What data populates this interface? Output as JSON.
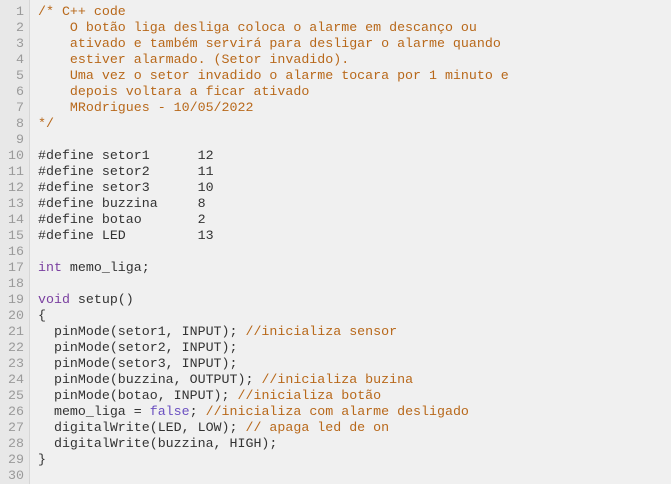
{
  "editor": {
    "colors": {
      "comment": "#b8681a",
      "keyword": "#7a3fa0",
      "literal": "#6a4fc0",
      "code": "#333333",
      "line_number": "#9a9a9a"
    },
    "lines": [
      {
        "n": "1",
        "tokens": [
          {
            "t": "/* C++ code",
            "c": "comment"
          }
        ]
      },
      {
        "n": "2",
        "tokens": [
          {
            "t": "    O botão liga desliga coloca o alarme em descanço ou",
            "c": "comment"
          }
        ]
      },
      {
        "n": "3",
        "tokens": [
          {
            "t": "    ativado e também servirá para desligar o alarme quando",
            "c": "comment"
          }
        ]
      },
      {
        "n": "4",
        "tokens": [
          {
            "t": "    estiver alarmado. (Setor invadido).",
            "c": "comment"
          }
        ]
      },
      {
        "n": "5",
        "tokens": [
          {
            "t": "    Uma vez o setor invadido o alarme tocara por 1 minuto e",
            "c": "comment"
          }
        ]
      },
      {
        "n": "6",
        "tokens": [
          {
            "t": "    depois voltara a ficar ativado",
            "c": "comment"
          }
        ]
      },
      {
        "n": "7",
        "tokens": [
          {
            "t": "    MRodrigues - 10/05/2022",
            "c": "comment"
          }
        ]
      },
      {
        "n": "8",
        "tokens": [
          {
            "t": "*/",
            "c": "comment"
          }
        ]
      },
      {
        "n": "9",
        "tokens": []
      },
      {
        "n": "10",
        "tokens": [
          {
            "t": "#define setor1      12",
            "c": "code"
          }
        ]
      },
      {
        "n": "11",
        "tokens": [
          {
            "t": "#define setor2      11",
            "c": "code"
          }
        ]
      },
      {
        "n": "12",
        "tokens": [
          {
            "t": "#define setor3      10",
            "c": "code"
          }
        ]
      },
      {
        "n": "13",
        "tokens": [
          {
            "t": "#define buzzina     8",
            "c": "code"
          }
        ]
      },
      {
        "n": "14",
        "tokens": [
          {
            "t": "#define botao       2",
            "c": "code"
          }
        ]
      },
      {
        "n": "15",
        "tokens": [
          {
            "t": "#define LED         13",
            "c": "code"
          }
        ]
      },
      {
        "n": "16",
        "tokens": []
      },
      {
        "n": "17",
        "tokens": [
          {
            "t": "int",
            "c": "kw"
          },
          {
            "t": " memo_liga;",
            "c": "code"
          }
        ]
      },
      {
        "n": "18",
        "tokens": []
      },
      {
        "n": "19",
        "tokens": [
          {
            "t": "void",
            "c": "kw"
          },
          {
            "t": " setup()",
            "c": "code"
          }
        ]
      },
      {
        "n": "20",
        "tokens": [
          {
            "t": "{",
            "c": "code"
          }
        ]
      },
      {
        "n": "21",
        "tokens": [
          {
            "t": "  pinMode(setor1, INPUT); ",
            "c": "code"
          },
          {
            "t": "//inicializa sensor",
            "c": "comment"
          }
        ]
      },
      {
        "n": "22",
        "tokens": [
          {
            "t": "  pinMode(setor2, INPUT);",
            "c": "code"
          }
        ]
      },
      {
        "n": "23",
        "tokens": [
          {
            "t": "  pinMode(setor3, INPUT);",
            "c": "code"
          }
        ]
      },
      {
        "n": "24",
        "tokens": [
          {
            "t": "  pinMode(buzzina, OUTPUT); ",
            "c": "code"
          },
          {
            "t": "//inicializa buzina",
            "c": "comment"
          }
        ]
      },
      {
        "n": "25",
        "tokens": [
          {
            "t": "  pinMode(botao, INPUT); ",
            "c": "code"
          },
          {
            "t": "//inicializa botão",
            "c": "comment"
          }
        ]
      },
      {
        "n": "26",
        "tokens": [
          {
            "t": "  memo_liga = ",
            "c": "code"
          },
          {
            "t": "false",
            "c": "lit"
          },
          {
            "t": "; ",
            "c": "code"
          },
          {
            "t": "//inicializa com alarme desligado",
            "c": "comment"
          }
        ]
      },
      {
        "n": "27",
        "tokens": [
          {
            "t": "  digitalWrite(LED, LOW); ",
            "c": "code"
          },
          {
            "t": "// apaga led de on",
            "c": "comment"
          }
        ]
      },
      {
        "n": "28",
        "tokens": [
          {
            "t": "  digitalWrite(buzzina, HIGH);",
            "c": "code"
          }
        ]
      },
      {
        "n": "29",
        "tokens": [
          {
            "t": "}",
            "c": "code"
          }
        ]
      },
      {
        "n": "30",
        "tokens": []
      }
    ]
  }
}
